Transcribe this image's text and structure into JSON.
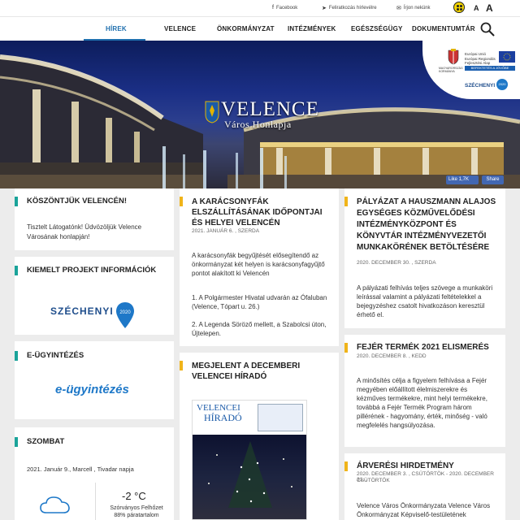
{
  "topbar": {
    "facebook": "Facebook",
    "newsletter": "Feliratkozás hírlevélre",
    "contacts": "Írjon nekünk",
    "font_small": "A",
    "font_large": "A"
  },
  "nav": {
    "items": [
      "HÍREK",
      "VELENCE",
      "ÖNKORMÁNYZAT",
      "INTÉZMÉNYEK",
      "EGÉSZSÉGÜGY",
      "DOKUMENTUMTÁR"
    ],
    "active": "HÍREK"
  },
  "hero": {
    "title": "VELENCE",
    "subtitle": "Város Honlapja",
    "sponsor": {
      "line1": "Európai Unió",
      "line2": "Európai Regionális",
      "line3": "Fejlesztési Alap",
      "country": "MAGYARORSZÁG KORMÁNYA",
      "banner": "BEFEKTETÉS A JÖVŐBE",
      "szechenyi": "SZÉCHENYI",
      "year": "2020"
    },
    "like_label": "Like 1,7K",
    "share_label": "Share"
  },
  "left_column": {
    "welcome": {
      "title": "KÖSZÖNTJÜK VELENCÉN!",
      "text": "Tisztelt Látogatónk! Üdvözöljük Velence Városának honlapján!"
    },
    "projects": {
      "title": "KIEMELT PROJEKT INFORMÁCIÓK",
      "logo": "SZÉCHENYI",
      "logo_year": "2020"
    },
    "eadmin": {
      "title": "E-ÜGYINTÉZÉS",
      "logo": "e-ügyintézés"
    },
    "weather": {
      "title": "SZOMBAT",
      "date_line": "2021. Január 9., Marcell , Tivadar napja",
      "temp": "-2 °C",
      "desc_line1": "Szórványos Felhőzet",
      "desc_line2": "88% páratartalom"
    }
  },
  "middle_column": {
    "news1": {
      "title": "A KARÁCSONYFÁK ELSZÁLLÍTÁSÁNAK IDŐPONTJAI ÉS HELYEI VELENCÉN",
      "date": "2021. JANUÁR 6. , SZERDA",
      "p1": "A karácsonyfák begyűjtését elősegítendő az önkormányzat két helyen is karácsonyfagyűjtő pontot alakított ki Velencén",
      "p2": "1. A Polgármester Hivatal udvarán az Ófaluban (Velence, Tópart u. 26.)",
      "p3": "2. A Legenda Söröző mellett, a Szabolcsi úton, Újtelepen."
    },
    "news2": {
      "title": "MEGJELENT A DECEMBERI VELENCEI HÍRADÓ",
      "paper_title1": "VELENCEI",
      "paper_title2": "HÍRADÓ"
    }
  },
  "right_column": {
    "news1": {
      "title": "PÁLYÁZAT A HAUSZMANN ALAJOS EGYSÉGES KÖZMŰVELŐDÉSI INTÉZMÉNYKÖZPONT ÉS KÖNYVTÁR INTÉZMÉNYVEZETŐI MUNKAKÖRÉNEK BETÖLTÉSÉRE",
      "date": "2020. DECEMBER 30. , SZERDA",
      "text": "A pályázati felhívás teljes szövege a munkaköri leírással valamint a pályázati feltételekkel a bejegyzéshez csatolt hivatkozáson keresztül érhető el."
    },
    "news2": {
      "title": "FEJÉR TERMÉK 2021 ELISMERÉS",
      "date": "2020. DECEMBER 8. , KEDD",
      "text": "A minősítés célja a figyelem felhívása a Fejér megyében előállított élelmiszerekre és kézműves termékekre, mint helyi termékekre, továbbá a Fejér Termék Program három pillérének - hagyomány, érték, minőség - való megfelelés hangsúlyozása."
    },
    "news3": {
      "title": "ÁRVERÉSI HIRDETMÉNY",
      "date_line1": "2020. DECEMBER 3. , CSÜTÖRTÖK - 2020. DECEMBER 31. ,",
      "date_line2": "CSÜTÖRTÖK",
      "text": "Velence Város Önkormányzata Velence Város Önkormányzat Képviselő-testületének"
    }
  },
  "colors": {
    "accent_blue": "#1f6fae",
    "teal": "#1aa39a",
    "gold": "#f0b41a"
  }
}
